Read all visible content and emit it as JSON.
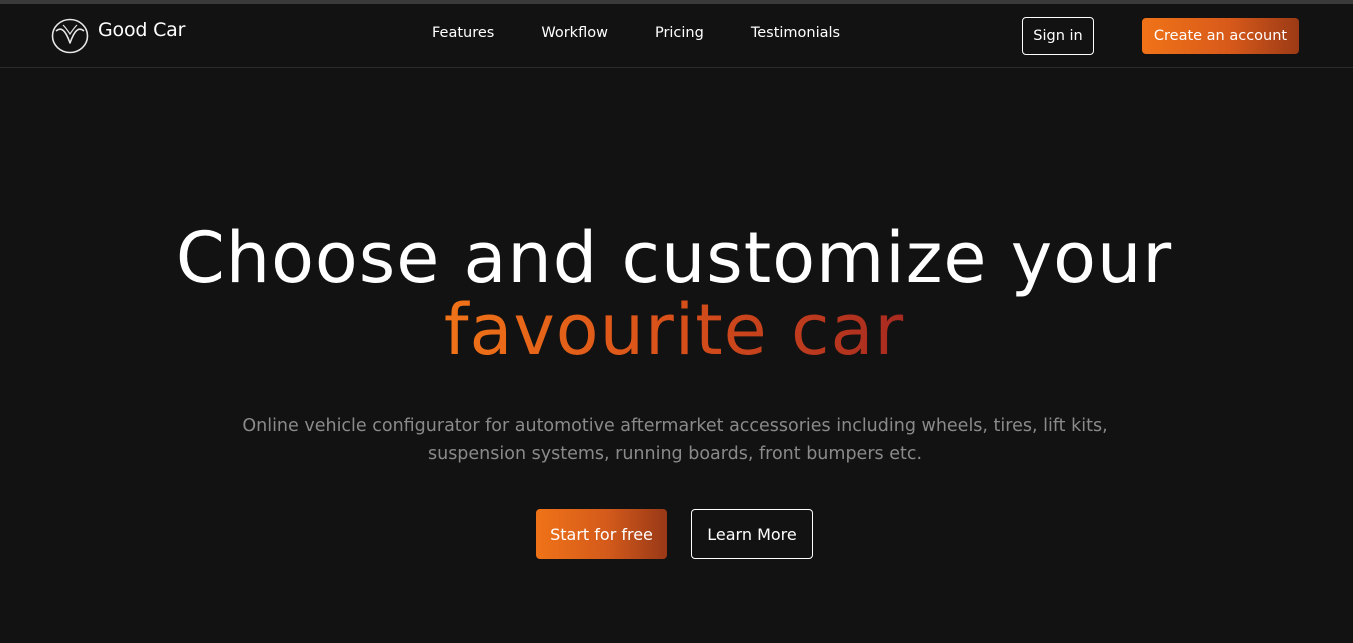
{
  "brand": {
    "name": "Good Car",
    "logo_icon": "mazda-logo-icon"
  },
  "nav": {
    "links": [
      "Features",
      "Workflow",
      "Pricing",
      "Testimonials"
    ],
    "sign_in_label": "Sign in",
    "create_account_label": "Create an account"
  },
  "hero": {
    "title_line1": "Choose and customize your",
    "title_line2": "favourite car",
    "subtitle": "Online vehicle configurator for automotive aftermarket accessories including wheels, tires, lift kits, suspension systems, running boards, front bumpers etc.",
    "primary_cta": "Start for free",
    "secondary_cta": "Learn More"
  },
  "colors": {
    "background": "#121212",
    "accent_start": "#f07318",
    "accent_end": "#9c3a16",
    "muted_text": "#8a8a8a"
  }
}
